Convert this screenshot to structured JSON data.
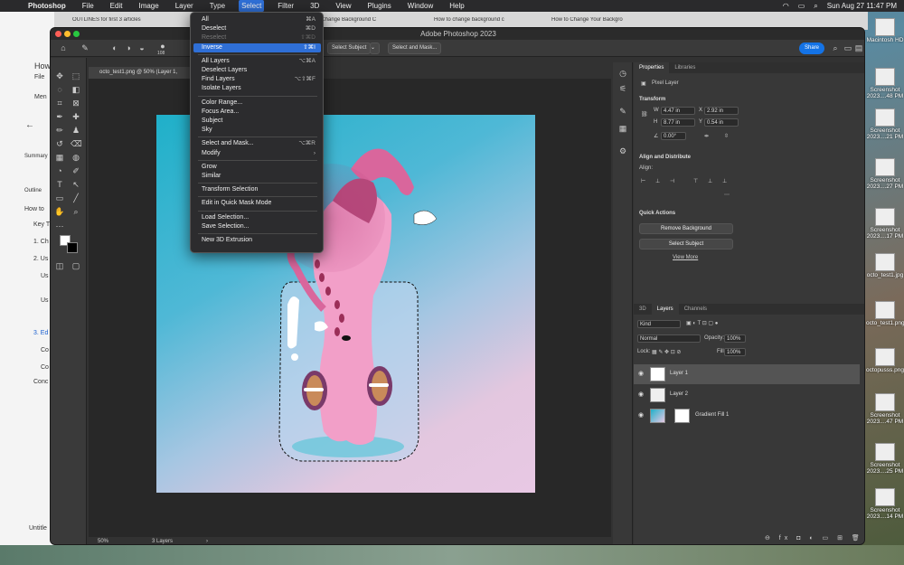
{
  "menubar": {
    "app": "Photoshop",
    "items": [
      "File",
      "Edit",
      "Image",
      "Layer",
      "Type",
      "Select",
      "Filter",
      "3D",
      "View",
      "Plugins",
      "Window",
      "Help"
    ],
    "active": "Select",
    "clock": "Sun Aug 27  11:47 PM"
  },
  "browser": {
    "tabs": [
      "OUTLINES for first 3 articles",
      "How to Change Background C",
      "How to change background c",
      "How to Change Your Backgro"
    ],
    "doc_items": [
      "How",
      "File",
      "Men",
      "Summary",
      "Outline",
      "How to",
      "Key T",
      "1. Ch",
      "2. Us",
      "Us",
      "Us",
      "3. Ed",
      "Co",
      "Co",
      "Conc",
      "Untitle"
    ]
  },
  "ps": {
    "window_title": "Adobe Photoshop 2023",
    "select_subject": "Select Subject",
    "select_and_mask": "Select and Mask...",
    "brush_size": "108",
    "share": "Share",
    "doc_tab": "octo_test1.png @ 50% (Layer 1,",
    "zoom": "50%",
    "layers_count": "3 Layers"
  },
  "select_menu": [
    {
      "label": "All",
      "shortcut": "⌘A",
      "disabled": false
    },
    {
      "label": "Deselect",
      "shortcut": "⌘D",
      "disabled": false
    },
    {
      "label": "Reselect",
      "shortcut": "⇧⌘D",
      "disabled": true
    },
    {
      "label": "Inverse",
      "shortcut": "⇧⌘I",
      "highlighted": true
    },
    {
      "sep": true
    },
    {
      "label": "All Layers",
      "shortcut": "⌥⌘A"
    },
    {
      "label": "Deselect Layers",
      "shortcut": ""
    },
    {
      "label": "Find Layers",
      "shortcut": "⌥⇧⌘F"
    },
    {
      "label": "Isolate Layers",
      "shortcut": ""
    },
    {
      "sep": true
    },
    {
      "label": "Color Range...",
      "shortcut": ""
    },
    {
      "label": "Focus Area...",
      "shortcut": ""
    },
    {
      "label": "Subject",
      "shortcut": ""
    },
    {
      "label": "Sky",
      "shortcut": ""
    },
    {
      "sep": true
    },
    {
      "label": "Select and Mask...",
      "shortcut": "⌥⌘R"
    },
    {
      "label": "Modify",
      "shortcut": "›"
    },
    {
      "sep": true
    },
    {
      "label": "Grow",
      "shortcut": ""
    },
    {
      "label": "Similar",
      "shortcut": ""
    },
    {
      "sep": true
    },
    {
      "label": "Transform Selection",
      "shortcut": ""
    },
    {
      "sep": true
    },
    {
      "label": "Edit in Quick Mask Mode",
      "shortcut": ""
    },
    {
      "sep": true
    },
    {
      "label": "Load Selection...",
      "shortcut": ""
    },
    {
      "label": "Save Selection...",
      "shortcut": ""
    },
    {
      "sep": true
    },
    {
      "label": "New 3D Extrusion",
      "shortcut": ""
    }
  ],
  "properties": {
    "tabs": [
      "Properties",
      "Libraries"
    ],
    "kind": "Pixel Layer",
    "transform_title": "Transform",
    "w": "4.47 in",
    "x": "2.92 in",
    "h": "8.77 in",
    "y": "0.54 in",
    "angle": "0.00°",
    "align_title": "Align and Distribute",
    "align_label": "Align:",
    "quick_title": "Quick Actions",
    "remove_bg": "Remove Background",
    "select_subject": "Select Subject",
    "view_more": "View More"
  },
  "layers": {
    "tabs": [
      "3D",
      "Layers",
      "Channels"
    ],
    "kind": "Kind",
    "blend": "Normal",
    "opacity_label": "Opacity:",
    "opacity": "100%",
    "lock_label": "Lock:",
    "fill_label": "Fill:",
    "fill": "100%",
    "items": [
      "Layer 1",
      "Layer 2",
      "Gradient Fill 1"
    ]
  },
  "desktop": [
    {
      "label": "Macintosh HD"
    },
    {
      "label": "Screenshot 2023....48 PM"
    },
    {
      "label": "Screenshot 2023....21 PM"
    },
    {
      "label": "Screenshot 2023....27 PM"
    },
    {
      "label": "Screenshot 2023....17 PM"
    },
    {
      "label": "octo_test1.jpg"
    },
    {
      "label": "octo_test1.png"
    },
    {
      "label": "octopusss.png"
    },
    {
      "label": "Screenshot 2023....47 PM"
    },
    {
      "label": "Screenshot 2023....25 PM"
    },
    {
      "label": "Screenshot 2023....14 PM"
    }
  ],
  "colors": {
    "accent": "#2f6fd6",
    "share": "#1473e6",
    "canvas_bg": "#282828",
    "panel": "#383838"
  }
}
